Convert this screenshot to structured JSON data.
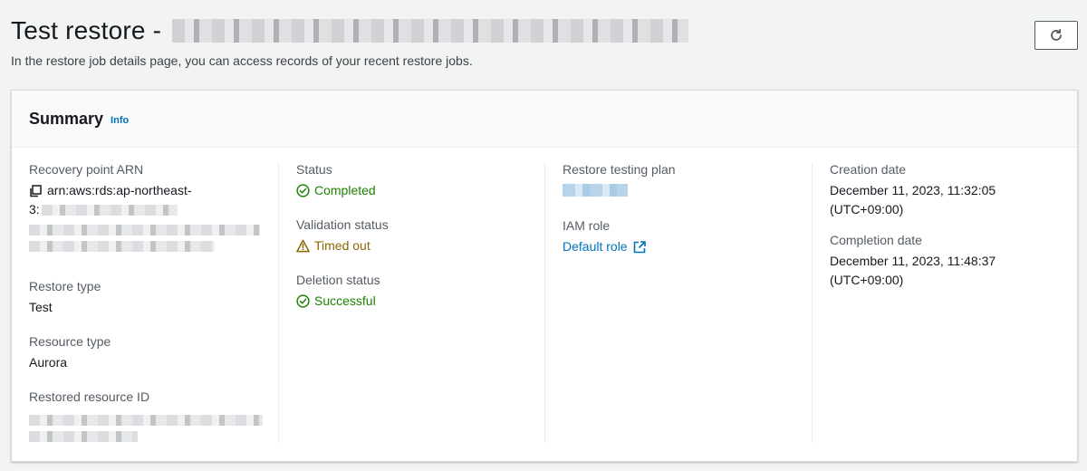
{
  "header": {
    "title": "Test restore -",
    "subtitle": "In the restore job details page, you can access records of your recent restore jobs."
  },
  "summary": {
    "title": "Summary",
    "info": "Info",
    "recovery_point_arn": {
      "label": "Recovery point ARN",
      "value_prefix": "arn:aws:rds:ap-northeast-",
      "value_line2": "3:"
    },
    "restore_type": {
      "label": "Restore type",
      "value": "Test"
    },
    "resource_type": {
      "label": "Resource type",
      "value": "Aurora"
    },
    "restored_resource_id": {
      "label": "Restored resource ID"
    },
    "status": {
      "label": "Status",
      "value": "Completed"
    },
    "validation_status": {
      "label": "Validation status",
      "value": "Timed out"
    },
    "deletion_status": {
      "label": "Deletion status",
      "value": "Successful"
    },
    "restore_testing_plan": {
      "label": "Restore testing plan"
    },
    "iam_role": {
      "label": "IAM role",
      "value": "Default role"
    },
    "creation_date": {
      "label": "Creation date",
      "line1": "December 11, 2023, 11:32:05",
      "line2": "(UTC+09:00)"
    },
    "completion_date": {
      "label": "Completion date",
      "line1": "December 11, 2023, 11:48:37",
      "line2": "(UTC+09:00)"
    }
  },
  "colors": {
    "success": "#1d8102",
    "warning": "#8d6605",
    "link": "#0073bb"
  },
  "icons": {
    "refresh": "refresh-icon",
    "copy": "copy-icon",
    "success": "check-circle-icon",
    "warning": "warning-triangle-icon",
    "external": "external-link-icon"
  }
}
